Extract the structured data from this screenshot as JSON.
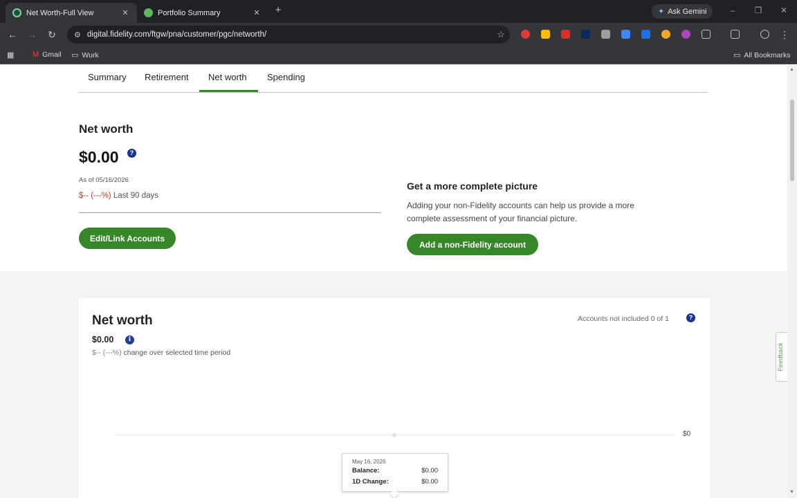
{
  "browser": {
    "tabs": [
      {
        "title": "Net Worth-Full View",
        "active": true,
        "favicon_color": "#4caf50"
      },
      {
        "title": "Portfolio Summary",
        "active": false,
        "favicon_color": "#5cb85c"
      }
    ],
    "new_tab_glyph": "+",
    "gemini_label": "Ask Gemini",
    "url": "digital.fidelity.com/ftgw/pna/customer/pgc/networth/",
    "bookmarks": [
      {
        "label": "Gmail",
        "icon": "gmail-icon"
      },
      {
        "label": "Wurk",
        "icon": "folder-icon"
      }
    ],
    "all_bookmarks": "All Bookmarks"
  },
  "subnav": {
    "tabs": [
      "Summary",
      "Retirement",
      "Net worth",
      "Spending"
    ],
    "active_index": 2
  },
  "networth": {
    "title": "Net worth",
    "amount": "$0.00",
    "help_glyph": "?",
    "as_of": "As of 05/16/2026",
    "change_value": "$-- (---%)",
    "change_period": "Last 90 days",
    "edit_button": "Edit/Link Accounts"
  },
  "complete_picture": {
    "title": "Get a more complete picture",
    "description": "Adding your non-Fidelity accounts can help us provide a more complete assessment of your financial picture.",
    "button": "Add a non-Fidelity account"
  },
  "chart_card": {
    "title": "Net worth",
    "amount": "$0.00",
    "info_glyph": "i",
    "change_value": "$-- (---%)",
    "change_text": "change over selected time period",
    "accounts_note": "Accounts not included 0 of 1",
    "help_glyph": "?",
    "tooltip": {
      "date": "May 16, 2026",
      "balance_label": "Balance:",
      "balance_value": "$0.00",
      "change_label": "1D Change:",
      "change_value": "$0.00"
    }
  },
  "chart_data": {
    "type": "line",
    "x": [
      "May 16, 2026"
    ],
    "series": [
      {
        "values": [
          0
        ]
      }
    ],
    "y_tick_labels": [
      "$0"
    ],
    "grid": false
  },
  "feedback_label": "Feedback",
  "colors": {
    "brand_green": "#368727",
    "help_blue": "#17358f",
    "negative": "#c0392b"
  }
}
